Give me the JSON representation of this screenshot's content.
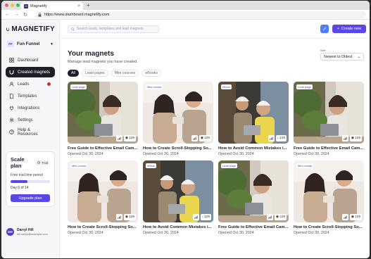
{
  "browser": {
    "tab_title": "Magnetify",
    "tab_close": "×",
    "new_tab": "+",
    "url": "https://www.dashboard.magnetify.com"
  },
  "sidebar": {
    "logo_text": "MAGNETIFY",
    "workspace": {
      "badge": "FF",
      "name": "Fun Funnel"
    },
    "items": [
      {
        "label": "Dashboard",
        "icon": "grid-icon",
        "active": false
      },
      {
        "label": "Created magnets",
        "icon": "magnet-icon",
        "active": true
      },
      {
        "label": "Leads",
        "icon": "user-icon",
        "active": false,
        "alert": true
      },
      {
        "label": "Templates",
        "icon": "file-icon",
        "active": false
      },
      {
        "label": "Integrations",
        "icon": "plug-icon",
        "active": false
      },
      {
        "label": "Settings",
        "icon": "gear-icon",
        "active": false
      },
      {
        "label": "Help & Resources",
        "icon": "help-icon",
        "active": false
      }
    ],
    "plan": {
      "title": "Scale plan",
      "badge": "Trial",
      "subtitle": "Free trial time period",
      "progress_fraction": 0.43,
      "day_text": "Day 6 of 14",
      "upgrade_label": "Upgrade plan"
    },
    "user": {
      "initials": "DH",
      "name": "Darryl Hill",
      "email": "hill.darryl@example.com"
    }
  },
  "topbar": {
    "search_placeholder": "Search leads, templates and lead magnets",
    "create_label": "Create new"
  },
  "main": {
    "title": "Your magnets",
    "subtitle": "Manage lead magnets you have created.",
    "sort_label": "Sort",
    "sort_value": "Newest to Oldest",
    "filters": [
      "All",
      "Lead pages",
      "Mini courses",
      "eBooks"
    ]
  },
  "cards": [
    {
      "tag": "Lead page",
      "title": "Free Guide to Effective Email Cam...",
      "date": "Opened Oct 30, 2024",
      "count": "129",
      "scene": "a"
    },
    {
      "tag": "Mini course",
      "title": "How to Create Scroll-Stopping So...",
      "date": "Opened Oct 30, 2024",
      "count": "129",
      "scene": "b"
    },
    {
      "tag": "eBook",
      "title": "How to Avoid Common Mistakes i...",
      "date": "Opened Oct 30, 2024",
      "count": "129",
      "scene": "c"
    },
    {
      "tag": "Lead page",
      "title": "Free Guide to Effective Email Cam...",
      "date": "Opened Oct 30, 2024",
      "count": "129",
      "scene": "a"
    },
    {
      "tag": "Mini course",
      "title": "How to Create Scroll-Stopping So...",
      "date": "Opened Oct 30, 2024",
      "count": "129",
      "scene": "b"
    },
    {
      "tag": "eBook",
      "title": "How to Avoid Common Mistakes i...",
      "date": "Opened Oct 30, 2024",
      "count": "129",
      "scene": "c"
    },
    {
      "tag": "Lead page",
      "title": "Free Guide to Effective Email Cam...",
      "date": "Opened Oct 30, 2024",
      "count": "129",
      "scene": "a"
    },
    {
      "tag": "Mini course",
      "title": "How to Create Scroll-Stopping So...",
      "date": "Opened Oct 30, 2024",
      "count": "129",
      "scene": "b"
    }
  ],
  "colors": {
    "accent": "#5b47e6",
    "sidebar_active": "#1e1e28",
    "alert": "#d62828"
  }
}
